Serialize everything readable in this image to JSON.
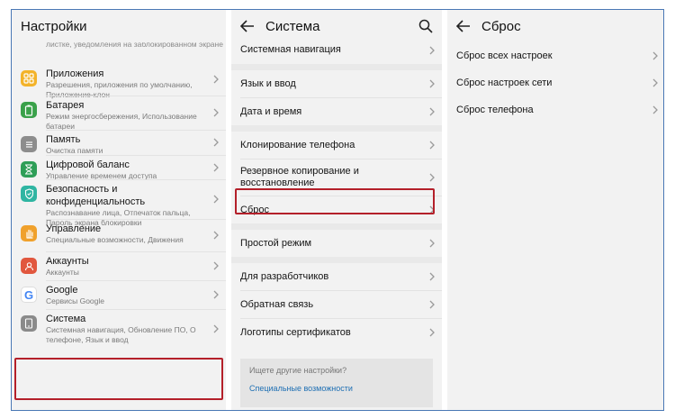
{
  "panel_settings": {
    "title": "Настройки",
    "cut_subtitle": "листке, уведомления на заблокированном экране",
    "cut_subtitle_2": "экране",
    "items": [
      {
        "name": "Приложения",
        "sub": "Разрешения, приложения по умолчанию, Приложение-клон",
        "icon": "apps-icon",
        "color": "#f3b32a"
      },
      {
        "name": "Батарея",
        "sub": "Режим энергосбережения, Использование батареи",
        "icon": "battery-icon",
        "color": "#3aa14a"
      },
      {
        "name": "Память",
        "sub": "Очистка памяти",
        "icon": "memory-icon",
        "color": "#8d8d8d"
      },
      {
        "name": "Цифровой баланс",
        "sub": "Управление временем доступа",
        "icon": "hourglass-icon",
        "color": "#2e9e57"
      },
      {
        "name": "Безопасность и конфиденциальность",
        "sub": "Распознавание лица, Отпечаток пальца, Пароль экрана блокировки",
        "icon": "shield-icon",
        "color": "#2fb5a2"
      },
      {
        "name": "Управление",
        "sub": "Специальные возможности, Движения",
        "icon": "hand-icon",
        "color": "#f0a12c"
      },
      {
        "name": "Аккаунты",
        "sub": "Аккаунты",
        "icon": "account-icon",
        "color": "#e1573e"
      },
      {
        "name": "Google",
        "sub": "Сервисы Google",
        "icon": "google-icon",
        "color": "#ffffff"
      },
      {
        "name": "Система",
        "sub": "Системная навигация, Обновление ПО, О телефоне, Язык и ввод",
        "icon": "system-icon",
        "color": "#8a8a8a"
      }
    ]
  },
  "panel_system": {
    "title": "Система",
    "rows": [
      "Системная навигация",
      "Язык и ввод",
      "Дата и время",
      "Клонирование телефона",
      "Резервное копирование и восстановление",
      "Сброс",
      "Простой режим",
      "Для разработчиков",
      "Обратная связь",
      "Логотипы сертификатов"
    ],
    "hint_question": "Ищете другие настройки?",
    "hint_link": "Специальные возможности"
  },
  "panel_reset": {
    "title": "Сброс",
    "rows": [
      "Сброс всех настроек",
      "Сброс настроек сети",
      "Сброс телефона"
    ]
  },
  "colors": {
    "highlight": "#b4202a",
    "link": "#1e6fb3",
    "panel_bg": "#f2f2f2"
  }
}
